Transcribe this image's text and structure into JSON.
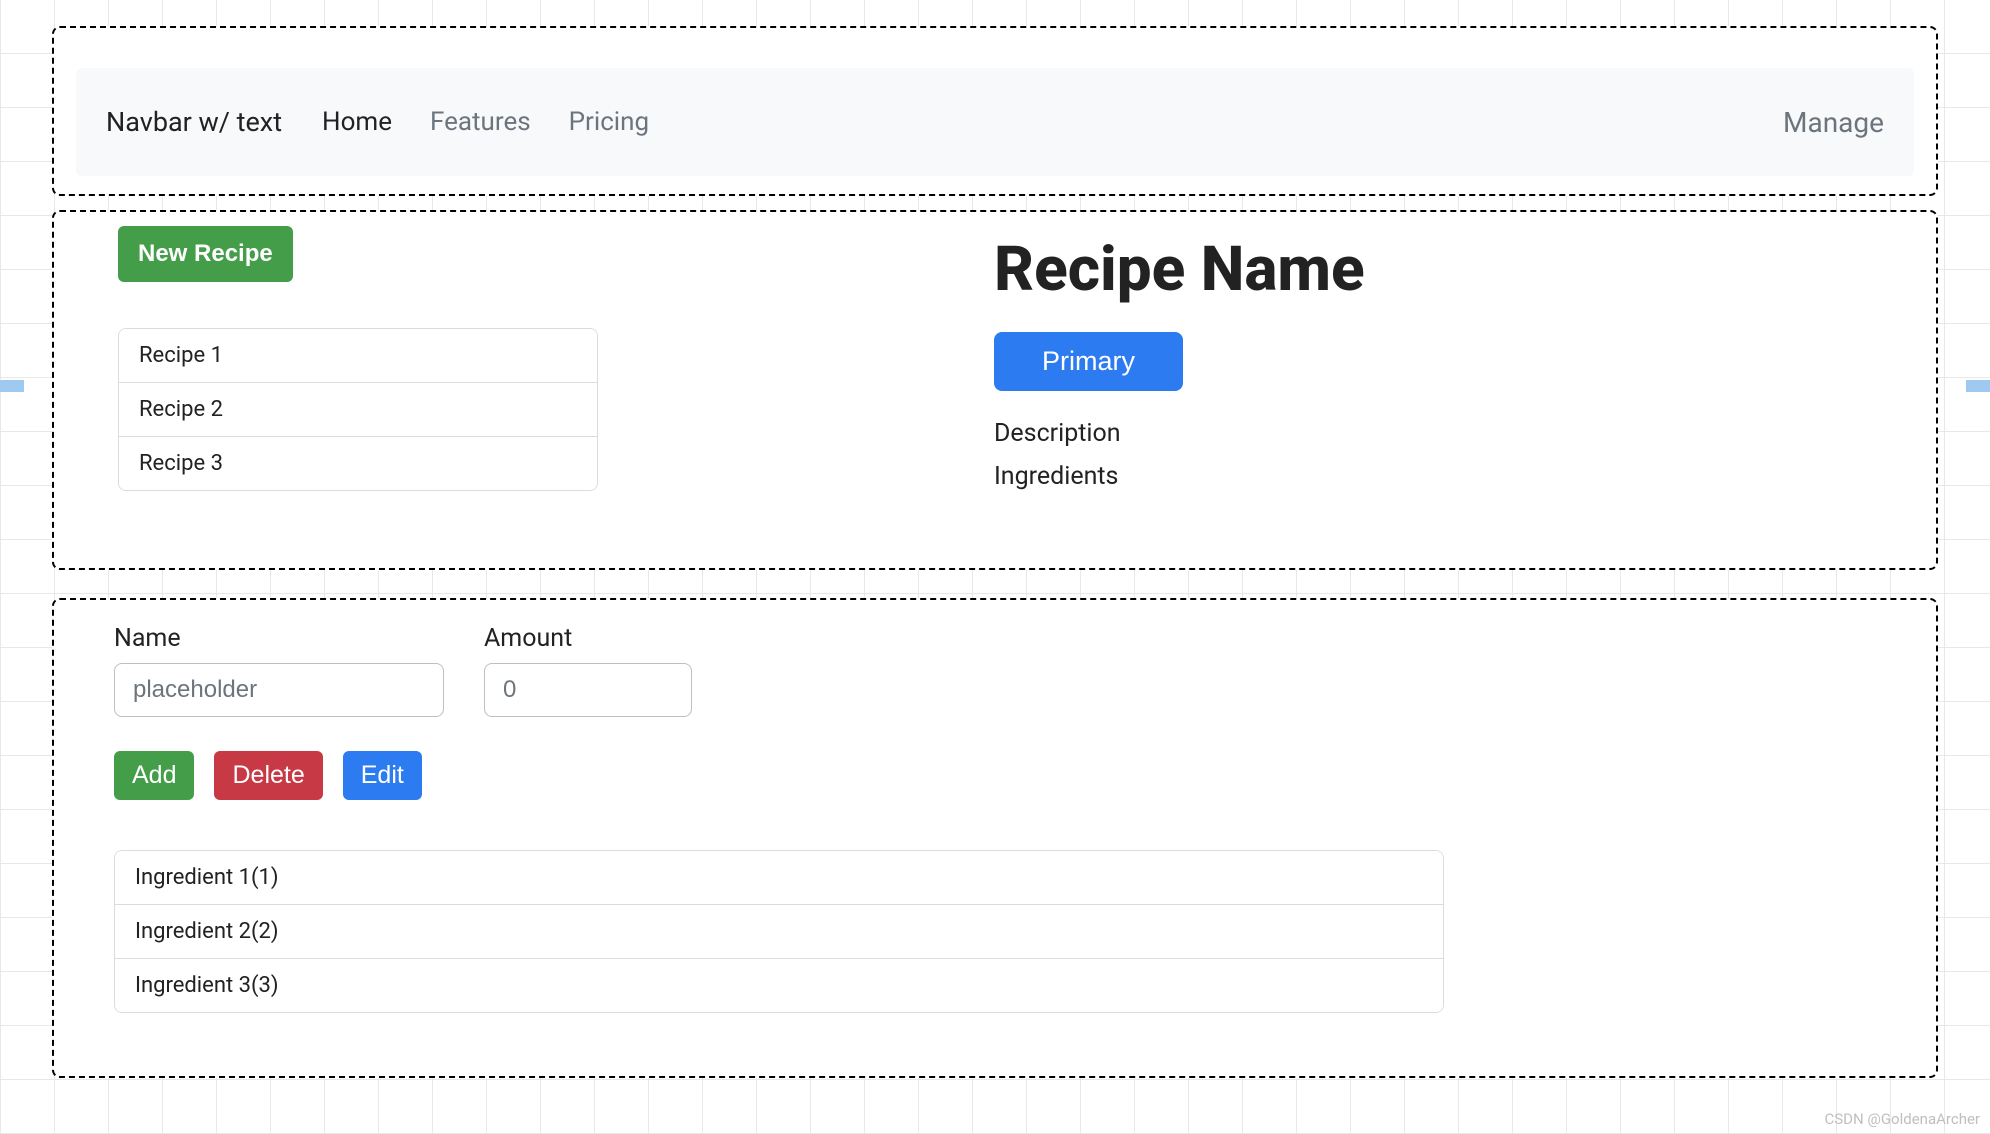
{
  "navbar": {
    "brand": "Navbar w/ text",
    "links": [
      {
        "label": "Home",
        "active": true
      },
      {
        "label": "Features",
        "active": false
      },
      {
        "label": "Pricing",
        "active": false
      }
    ],
    "right_label": "Manage"
  },
  "recipe_section": {
    "new_button": "New Recipe",
    "recipes": [
      "Recipe 1",
      "Recipe 2",
      "Recipe 3"
    ],
    "detail": {
      "title": "Recipe Name",
      "primary_button": "Primary",
      "description_label": "Description",
      "ingredients_label": "Ingredients"
    }
  },
  "edit_section": {
    "name_label": "Name",
    "name_placeholder": "placeholder",
    "amount_label": "Amount",
    "amount_placeholder": "0",
    "buttons": {
      "add": "Add",
      "delete": "Delete",
      "edit": "Edit"
    },
    "ingredients": [
      "Ingredient 1(1)",
      "Ingredient 2(2)",
      "Ingredient 3(3)"
    ]
  },
  "watermark": "CSDN @GoldenaArcher"
}
